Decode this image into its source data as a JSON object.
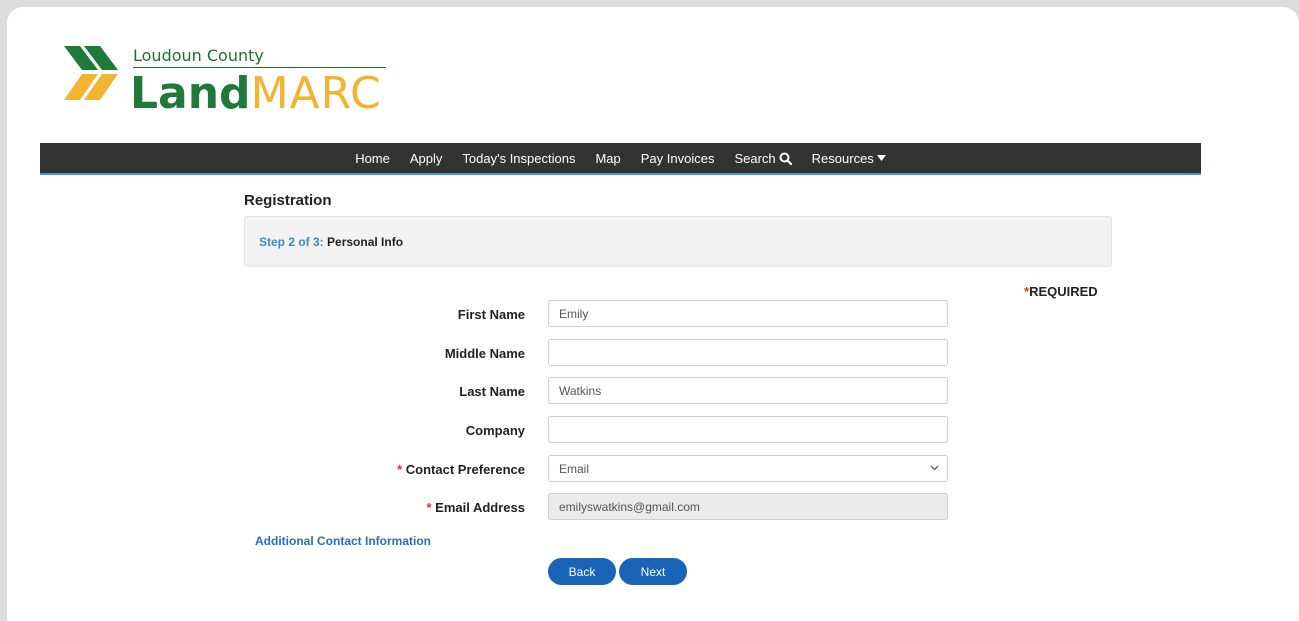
{
  "logo": {
    "county": "Loudoun County",
    "land": "Land",
    "marc": "MARC"
  },
  "nav": {
    "items": [
      "Home",
      "Apply",
      "Today's Inspections",
      "Map",
      "Pay Invoices"
    ],
    "search_label": "Search",
    "resources_label": "Resources"
  },
  "page": {
    "title": "Registration",
    "step_num": "Step 2 of 3:",
    "step_name": "Personal Info",
    "required_star": "*",
    "required_text": "REQUIRED"
  },
  "form": {
    "first_name": {
      "label": "First Name",
      "value": "Emily"
    },
    "middle_name": {
      "label": "Middle Name",
      "value": ""
    },
    "last_name": {
      "label": "Last Name",
      "value": "Watkins"
    },
    "company": {
      "label": "Company",
      "value": ""
    },
    "contact_preference": {
      "star": "*",
      "label": "Contact Preference",
      "value": "Email"
    },
    "email": {
      "star": "*",
      "label": "Email Address",
      "value": "emilyswatkins@gmail.com"
    }
  },
  "links": {
    "additional": "Additional Contact Information"
  },
  "buttons": {
    "back": "Back",
    "next": "Next"
  },
  "colors": {
    "brand_green": "#1f7a3a",
    "brand_gold": "#f2b431",
    "navbar": "#333333",
    "accent_blue": "#1a64b8",
    "required_red": "#d9342b"
  },
  "icons": {
    "search": "search-icon",
    "resources_caret": "caret-down-icon",
    "select_chevron": "chevron-down-icon"
  }
}
